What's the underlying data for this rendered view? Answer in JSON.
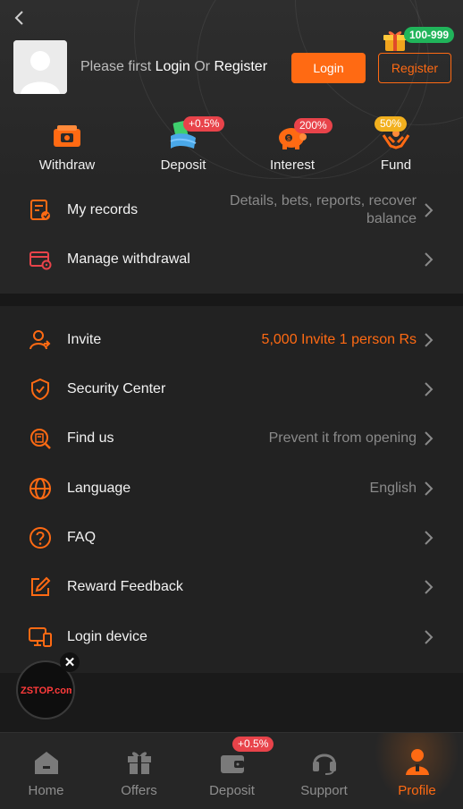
{
  "header": {
    "prompt_prefix": "Please first",
    "prompt_login": "Login",
    "prompt_or": "Or",
    "prompt_register": "Register",
    "login_button": "Login",
    "register_button": "Register",
    "gift_badge": "100-999"
  },
  "quick_actions": [
    {
      "label": "Withdraw",
      "icon": "ticket-icon",
      "badge": ""
    },
    {
      "label": "Deposit",
      "icon": "wallet-money-icon",
      "badge": "+0.5%"
    },
    {
      "label": "Interest",
      "icon": "piggy-bank-icon",
      "badge": "200%"
    },
    {
      "label": "Fund",
      "icon": "hands-coin-icon",
      "badge": "50%"
    }
  ],
  "menu_top": [
    {
      "label": "My records",
      "value_line1": "Details, bets, reports, recover",
      "value_line2": "balance",
      "icon": "records-icon"
    },
    {
      "label": "Manage withdrawal",
      "value_line1": "",
      "value_line2": "",
      "icon": "card-settings-icon"
    }
  ],
  "menu_main": [
    {
      "label": "Invite",
      "value_amount": "5,000",
      "value_text": "Invite 1 person Rs",
      "icon": "invite-user-icon"
    },
    {
      "label": "Security Center",
      "value": "",
      "icon": "shield-icon"
    },
    {
      "label": "Find us",
      "value": "Prevent it from opening",
      "icon": "search-document-icon"
    },
    {
      "label": "Language",
      "value": "English",
      "icon": "globe-icon"
    },
    {
      "label": "FAQ",
      "value": "",
      "icon": "question-icon"
    },
    {
      "label": "Reward Feedback",
      "value": "",
      "icon": "edit-icon"
    },
    {
      "label": "Login device",
      "value": "",
      "icon": "devices-icon"
    }
  ],
  "floating": {
    "logo_text": "ZSTOP.com",
    "close": "✕"
  },
  "tabbar": [
    {
      "label": "Home",
      "icon": "home-icon",
      "badge": ""
    },
    {
      "label": "Offers",
      "icon": "gift-icon",
      "badge": ""
    },
    {
      "label": "Deposit",
      "icon": "wallet-icon",
      "badge": "+0.5%"
    },
    {
      "label": "Support",
      "icon": "headset-icon",
      "badge": ""
    },
    {
      "label": "Profile",
      "icon": "person-icon",
      "badge": ""
    }
  ],
  "colors": {
    "accent": "#ff6a13",
    "badge_red": "#e8434a",
    "badge_green": "#20b45a",
    "badge_gold": "#f2b01e"
  }
}
